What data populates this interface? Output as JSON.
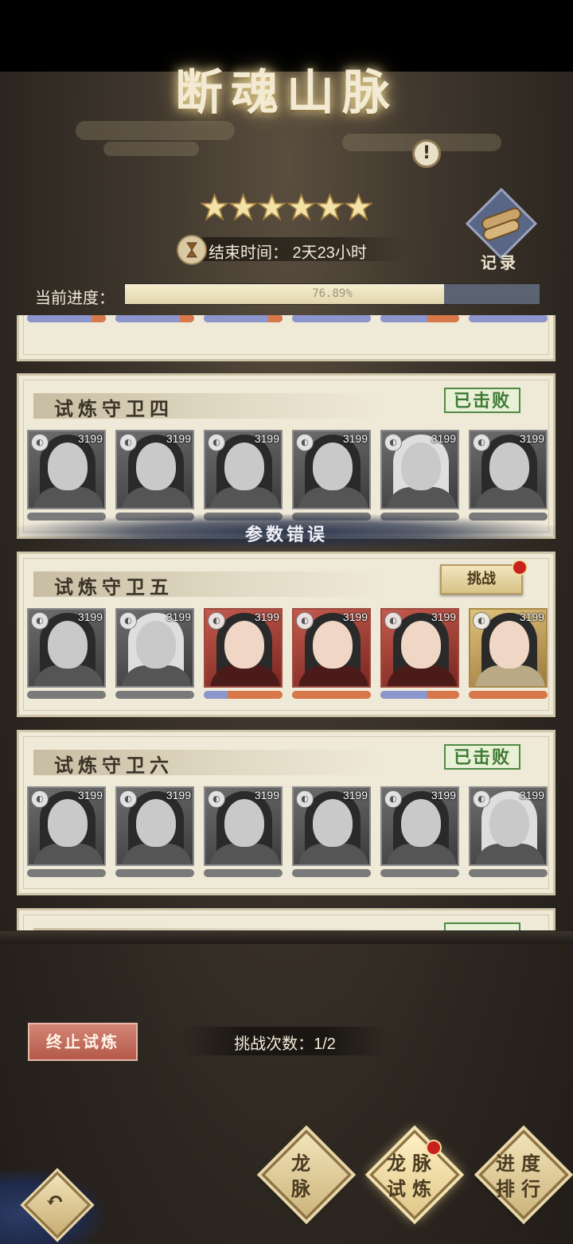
{
  "header": {
    "title": "断魂山脉",
    "info_icon": "info-icon",
    "stars": 6,
    "end_time_label": "结束时间：",
    "end_time_value": "2天23小时",
    "end_time_text": "结束时间：  2天23小时",
    "record_label": "记录"
  },
  "progress": {
    "label": "当前进度：",
    "percent_text": "76.89%",
    "value": 0.7689
  },
  "panels": [
    {
      "title": "试炼守卫四",
      "status": "已击败",
      "cards": [
        {
          "power": "3199",
          "tone": "gray",
          "hp": 0
        },
        {
          "power": "3199",
          "tone": "gray",
          "hp": 0
        },
        {
          "power": "3199",
          "tone": "gray",
          "hp": 0
        },
        {
          "power": "3199",
          "tone": "gray",
          "hp": 0
        },
        {
          "power": "3199",
          "tone": "light",
          "hp": 0
        },
        {
          "power": "3199",
          "tone": "gray",
          "hp": 0
        }
      ]
    },
    {
      "title": "试炼守卫五",
      "status": "挑战",
      "cards": [
        {
          "power": "3199",
          "tone": "gray",
          "hp": 0
        },
        {
          "power": "3199",
          "tone": "light",
          "hp": 0
        },
        {
          "power": "3199",
          "tone": "red",
          "hp": 0.3
        },
        {
          "power": "3199",
          "tone": "red",
          "hp": 0
        },
        {
          "power": "3199",
          "tone": "red",
          "hp": 0.6
        },
        {
          "power": "3199",
          "tone": "gold",
          "hp": 0
        }
      ]
    },
    {
      "title": "试炼守卫六",
      "status": "已击败",
      "cards": [
        {
          "power": "3199",
          "tone": "gray",
          "hp": 0
        },
        {
          "power": "3199",
          "tone": "gray",
          "hp": 0
        },
        {
          "power": "3199",
          "tone": "gray",
          "hp": 0
        },
        {
          "power": "3199",
          "tone": "gray",
          "hp": 0
        },
        {
          "power": "3199",
          "tone": "gray",
          "hp": 0
        },
        {
          "power": "3199",
          "tone": "light",
          "hp": 0
        }
      ]
    }
  ],
  "toast": "参数错误",
  "footer": {
    "stop_label": "终止试炼",
    "count_text": "挑战次数：1/2"
  },
  "nav": [
    {
      "line1": "龙",
      "line2": "脉"
    },
    {
      "line1": "龙脉",
      "line2": "试炼"
    },
    {
      "line1": "进度",
      "line2": "排行"
    }
  ],
  "colors": {
    "panel_bg": "#efe9d8",
    "defeated_green": "#3f7a35",
    "progress_fill": "#f5edd0",
    "progress_track": "#5b6272",
    "alert_red": "#c8201a"
  }
}
